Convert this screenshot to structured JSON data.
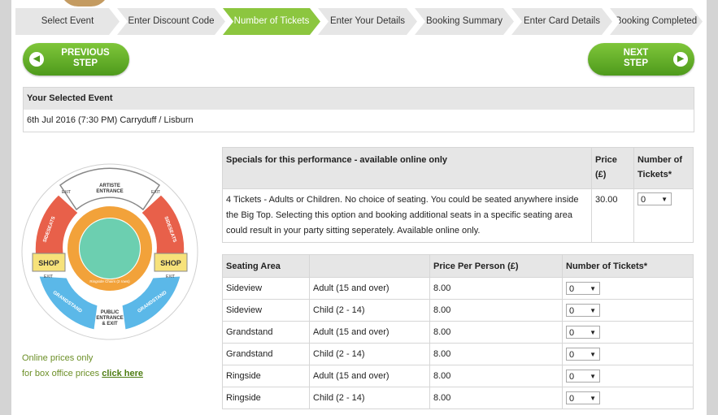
{
  "steps": [
    {
      "label": "Select Event",
      "active": false
    },
    {
      "label": "Enter Discount Code",
      "active": false
    },
    {
      "label": "Number of Tickets",
      "active": true
    },
    {
      "label": "Enter Your Details",
      "active": false
    },
    {
      "label": "Booking Summary",
      "active": false
    },
    {
      "label": "Enter Card Details",
      "active": false
    },
    {
      "label": "Booking Completed",
      "active": false
    }
  ],
  "nav": {
    "prev_line1": "PREVIOUS",
    "prev_line2": "STEP",
    "next_line1": "NEXT",
    "next_line2": "STEP"
  },
  "event": {
    "heading": "Your Selected Event",
    "details": "6th Jul 2016 (7:30 PM) Carryduff / Lisburn"
  },
  "map": {
    "artiste": "ARTISTE\nENTRANCE",
    "exit": "EXIT",
    "sideseats": "SIDESEATS",
    "shop": "SHOP",
    "grandstand": "GRANDSTAND",
    "ringside": "Ringside Chairs (2 rows)",
    "public": "PUBLIC\nENTRANCE\n& EXIT"
  },
  "notes": {
    "line1": "Online prices only",
    "line2_prefix": "for box office prices",
    "link": "click here"
  },
  "specials": {
    "headers": [
      "Specials for this performance - available online only",
      "Price (£)",
      "Number of Tickets*"
    ],
    "row": {
      "description": "4 Tickets - Adults or Children. No choice of seating. You could be seated anywhere inside the Big Top. Selecting this option and booking additional seats in a specific seating area could result in your party sitting seperately. Available online only.",
      "price": "30.00",
      "qty": "0"
    }
  },
  "areas": {
    "headers": [
      "Seating Area",
      "",
      "Price Per Person (£)",
      "Number of Tickets*"
    ],
    "rows": [
      {
        "area": "Sideview",
        "type": "Adult (15 and over)",
        "price": "8.00",
        "qty": "0"
      },
      {
        "area": "Sideview",
        "type": "Child (2 - 14)",
        "price": "8.00",
        "qty": "0"
      },
      {
        "area": "Grandstand",
        "type": "Adult (15 and over)",
        "price": "8.00",
        "qty": "0"
      },
      {
        "area": "Grandstand",
        "type": "Child (2 - 14)",
        "price": "8.00",
        "qty": "0"
      },
      {
        "area": "Ringside",
        "type": "Adult (15 and over)",
        "price": "8.00",
        "qty": "0"
      },
      {
        "area": "Ringside",
        "type": "Child (2 - 14)",
        "price": "8.00",
        "qty": "0"
      }
    ]
  },
  "colors": {
    "accent_green": "#8cc63f",
    "sideseats": "#e8604a",
    "grandstand": "#5bb8e8",
    "ringside": "#f2a23a",
    "ring": "#6ccfb0",
    "shop": "#f7e27a"
  }
}
